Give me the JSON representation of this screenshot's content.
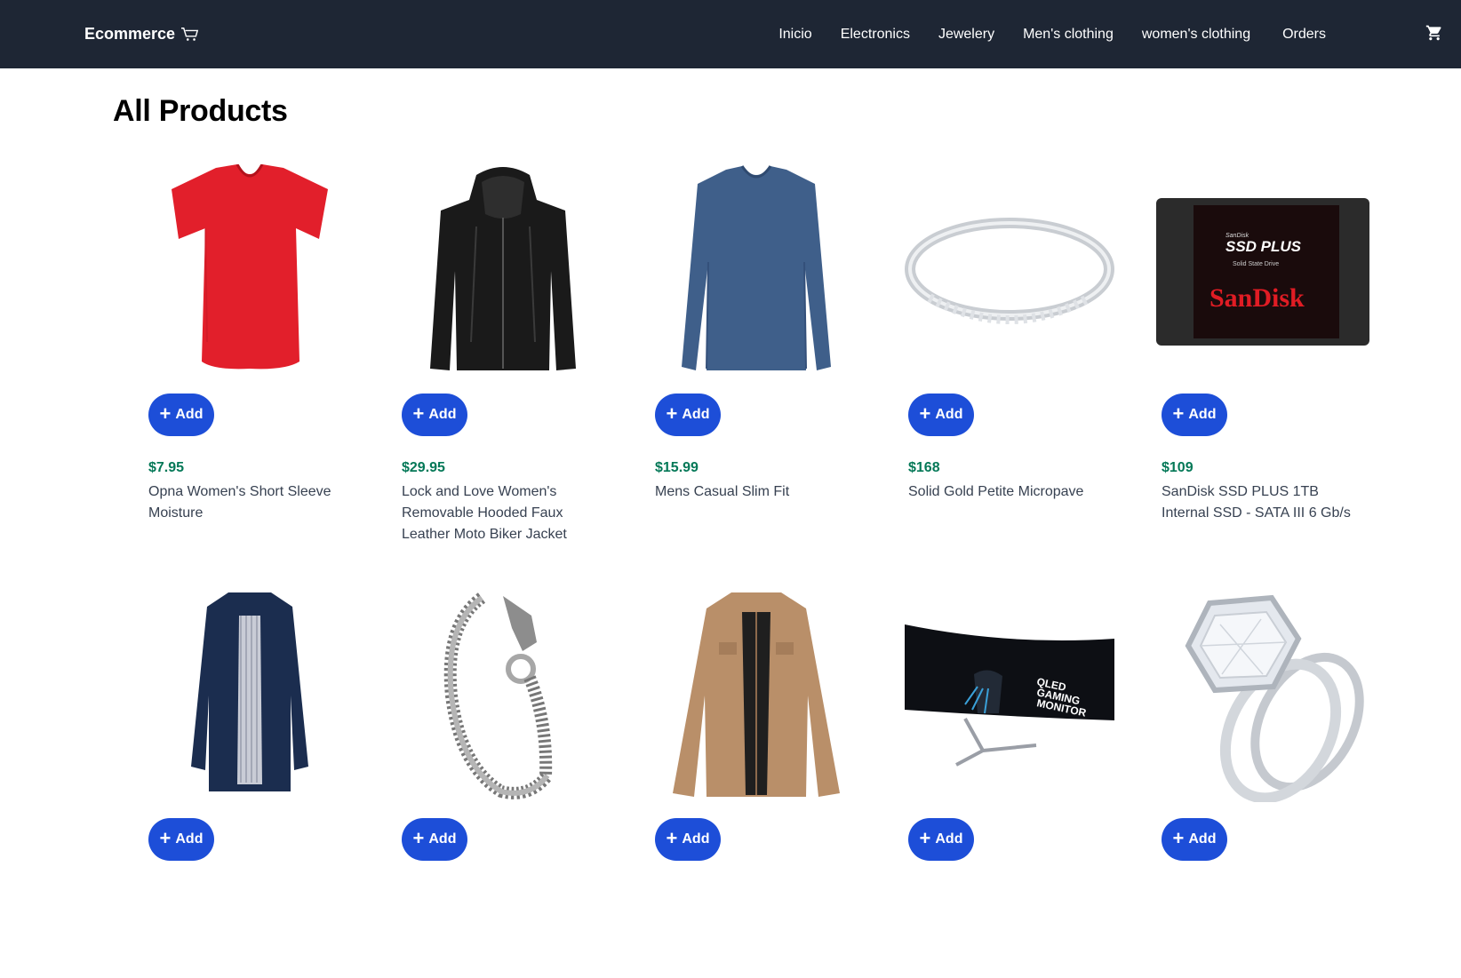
{
  "brand": {
    "name": "Ecommerce",
    "icon": "cart-outline-icon"
  },
  "nav": {
    "links": [
      "Inicio",
      "Electronics",
      "Jewelery",
      "Men's clothing",
      "women's clothing",
      "Orders"
    ],
    "cart_icon": "shopping-cart-icon"
  },
  "page": {
    "title": "All Products"
  },
  "products": [
    {
      "price": "$7.95",
      "title": "Opna Women's Short Sleeve Moisture",
      "add_label": "Add",
      "image": "red-vneck-tshirt"
    },
    {
      "price": "$29.95",
      "title": "Lock and Love Women's Removable Hooded Faux Leather Moto Biker Jacket",
      "add_label": "Add",
      "image": "black-leather-jacket"
    },
    {
      "price": "$15.99",
      "title": "Mens Casual Slim Fit",
      "add_label": "Add",
      "image": "blue-longsleeve-shirt"
    },
    {
      "price": "$168",
      "title": "Solid Gold Petite Micropave",
      "add_label": "Add",
      "image": "silver-ring"
    },
    {
      "price": "$109",
      "title": "SanDisk SSD PLUS 1TB Internal SSD - SATA III 6 Gb/s",
      "add_label": "Add",
      "image": "sandisk-ssd"
    },
    {
      "price": "",
      "title": "",
      "add_label": "Add",
      "image": "navy-rain-jacket"
    },
    {
      "price": "",
      "title": "",
      "add_label": "Add",
      "image": "dragon-bracelet"
    },
    {
      "price": "",
      "title": "",
      "add_label": "Add",
      "image": "tan-cotton-jacket"
    },
    {
      "price": "",
      "title": "",
      "add_label": "Add",
      "image": "curved-gaming-monitor"
    },
    {
      "price": "",
      "title": "",
      "add_label": "Add",
      "image": "diamond-ring-set"
    }
  ],
  "image_text": {
    "ssd_brand_small": "SanDisk",
    "ssd_model": "SSD PLUS",
    "ssd_sub": "Solid State Drive",
    "ssd_logo": "SanDisk",
    "monitor_line1": "QLED",
    "monitor_line2": "GAMING",
    "monitor_line3": "MONITOR"
  },
  "colors": {
    "nav_bg": "#1e2634",
    "button": "#1d4ed8",
    "price": "#047857"
  }
}
